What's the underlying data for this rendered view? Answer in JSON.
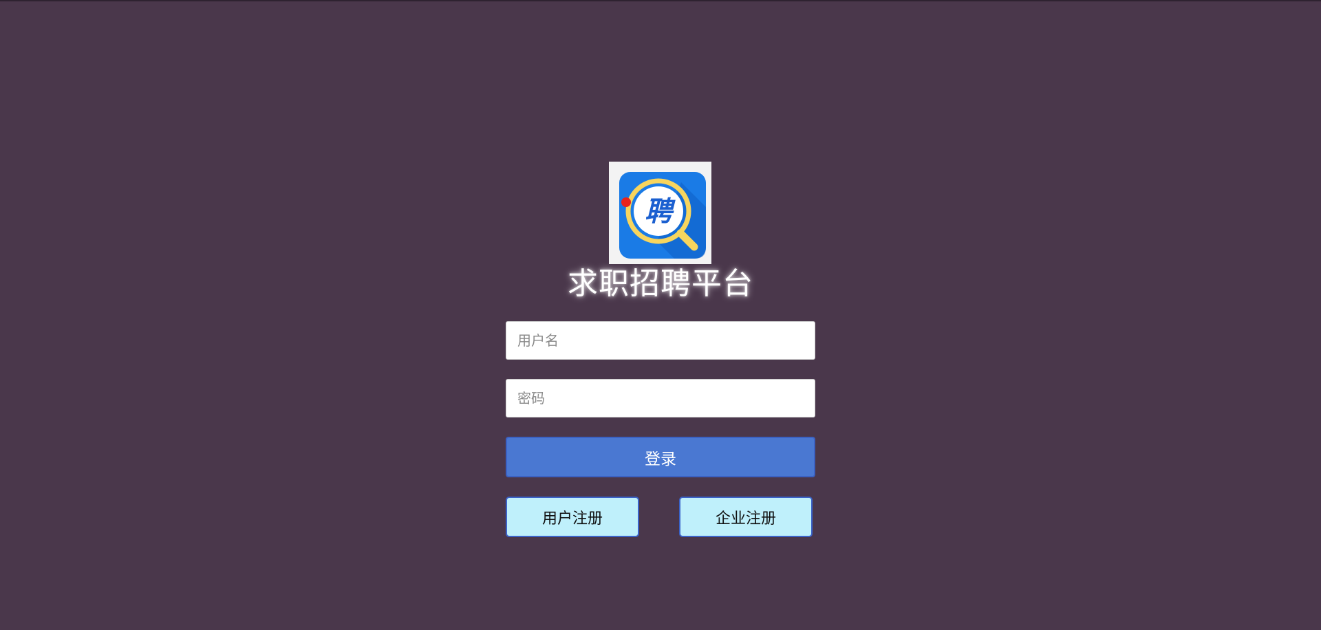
{
  "app": {
    "title": "求职招聘平台",
    "logo_icon": "recruit-magnifier-logo",
    "logo_char": "聘"
  },
  "form": {
    "username_placeholder": "用户名",
    "password_placeholder": "密码",
    "login_label": "登录"
  },
  "register": {
    "user_label": "用户注册",
    "company_label": "企业注册"
  },
  "colors": {
    "background": "#4a374b",
    "login_button": "#4a78d2",
    "register_button": "#bff0fb",
    "logo_blue": "#1a7be6",
    "logo_ring": "#f7d55e"
  }
}
